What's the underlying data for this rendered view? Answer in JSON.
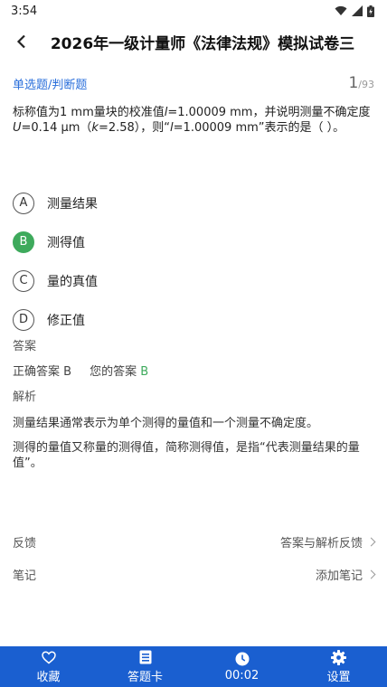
{
  "status_bar": {
    "time": "3:54"
  },
  "header": {
    "title": "2026年一级计量师《法律法规》模拟试卷三"
  },
  "question": {
    "type_label": "单选题/判断题",
    "current": "1",
    "total": "/93",
    "line1_a": "标称值为1 mm量块的校准值",
    "line1_var": "l",
    "line1_b": "=1.00009 mm，并说明测量不确定度",
    "line2_var1": "U",
    "line2_a": "=0.14 μm（",
    "line2_var2": "k",
    "line2_b": "=2.58），则“",
    "line2_var3": "l",
    "line2_c": "=1.00009 mm”表示的是（   ）。"
  },
  "options": [
    {
      "letter": "A",
      "text": "测量结果"
    },
    {
      "letter": "B",
      "text": "测得值"
    },
    {
      "letter": "C",
      "text": "量的真值"
    },
    {
      "letter": "D",
      "text": "修正值"
    }
  ],
  "answer": {
    "heading": "答案",
    "correct_label": "正确答案 B",
    "yours_prefix": "您的答案",
    "yours_value": "B"
  },
  "analysis": {
    "heading": "解析",
    "p1": "测量结果通常表示为单个测得的量值和一个测量不确定度。",
    "p2": "测得的量值又称量的测得值，简称测得值，是指“代表测量结果的量值”。"
  },
  "feedback": {
    "label": "反馈",
    "action": "答案与解析反馈"
  },
  "notes": {
    "label": "笔记",
    "action": "添加笔记"
  },
  "bottom_tabs": {
    "favorite": "收藏",
    "answer_card": "答题卡",
    "timer": "00:02",
    "settings": "设置"
  },
  "colors": {
    "accent": "#1a5fd0",
    "type_label": "#2a6fdb",
    "correct_green": "#3eaa5c"
  }
}
